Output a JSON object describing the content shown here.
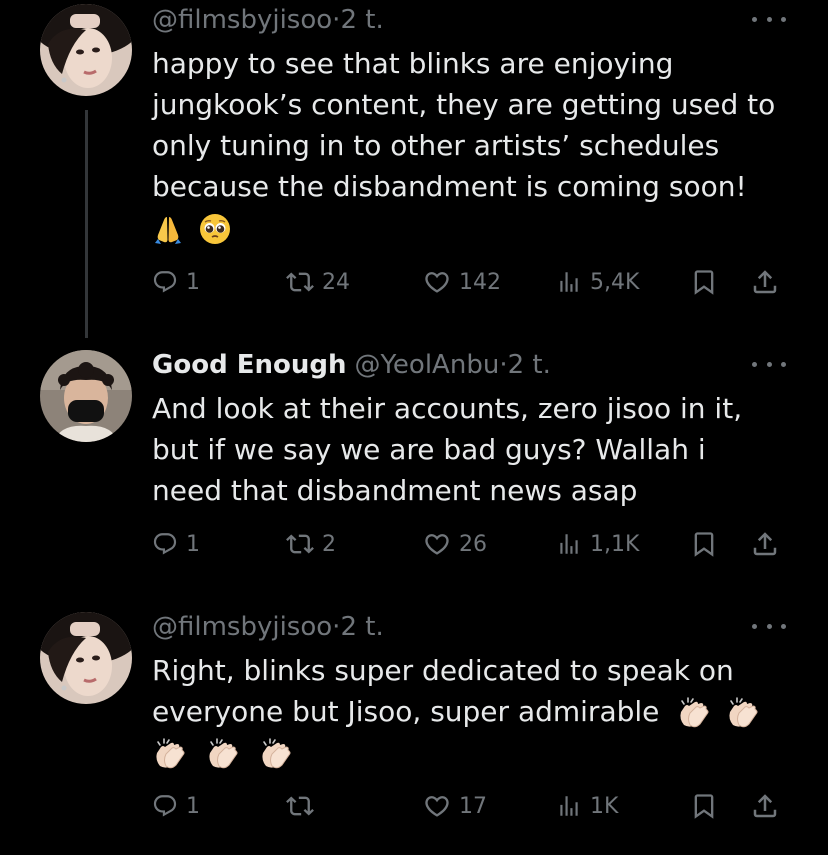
{
  "tweets": [
    {
      "name": "",
      "handle": "@filmsbyjisoo",
      "sep": "·",
      "time": "2 t.",
      "text_lines": [
        "happy to see that blinks are enjoying",
        "jungkook’s content, they are getting used to",
        "only tuning in to other artists’ schedules",
        "because the disbandment is coming soon!"
      ],
      "emojis": [
        "folded-hands",
        "pleading-face"
      ],
      "replies": "1",
      "retweets": "24",
      "likes": "142",
      "views": "5,4K"
    },
    {
      "name": "Good Enough",
      "handle": "@YeolAnbu",
      "sep": "·",
      "time": "2 t.",
      "text_lines": [
        "And look at their accounts, zero jisoo in it,",
        "but if we say we are bad guys? Wallah i",
        "need that disbandment news asap"
      ],
      "emojis": [],
      "replies": "1",
      "retweets": "2",
      "likes": "26",
      "views": "1,1K"
    },
    {
      "name": "",
      "handle": "@filmsbyjisoo",
      "sep": "·",
      "time": "2 t.",
      "text_lines": [
        "Right, blinks super dedicated to speak on",
        "everyone but Jisoo, super admirable"
      ],
      "emojis": [
        "clapping-hands",
        "clapping-hands",
        "clapping-hands",
        "clapping-hands",
        "clapping-hands"
      ],
      "replies": "1",
      "retweets": "",
      "likes": "17",
      "views": "1K"
    }
  ],
  "icons": {
    "reply": "reply-icon",
    "retweet": "retweet-icon",
    "like": "heart-icon",
    "views": "views-icon",
    "bookmark": "bookmark-icon",
    "share": "share-icon",
    "more": "more-icon"
  },
  "colors": {
    "background": "#000000",
    "text": "#e7e9ea",
    "secondary": "#71767b",
    "thread_line": "#333639"
  }
}
